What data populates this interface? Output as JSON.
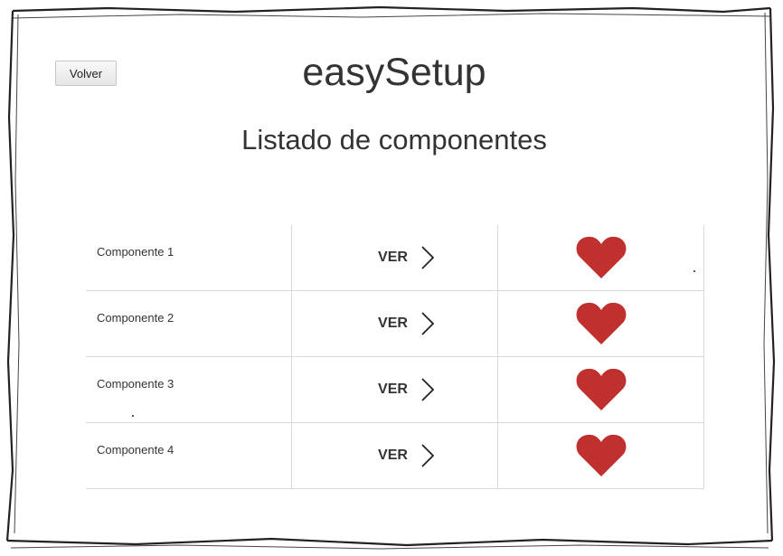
{
  "header": {
    "back_label": "Volver",
    "app_title": "easySetup",
    "subtitle": "Listado de componentes"
  },
  "components": [
    {
      "name": "Componente 1",
      "action": "VER"
    },
    {
      "name": "Componente 2",
      "action": "VER"
    },
    {
      "name": "Componente 3",
      "action": "VER"
    },
    {
      "name": "Componente 4",
      "action": "VER"
    }
  ],
  "colors": {
    "heart": "#c0302f",
    "border": "#d9d9d9",
    "text": "#333333"
  },
  "icons": {
    "action": "chevron-right-icon",
    "favorite": "heart-icon"
  }
}
